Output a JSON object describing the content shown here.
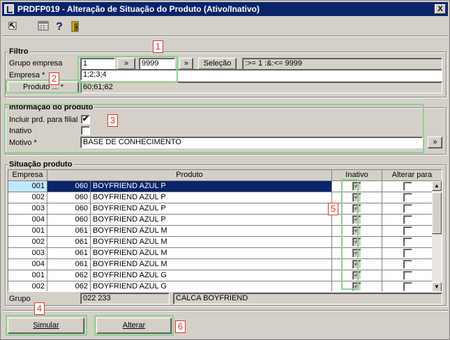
{
  "window": {
    "title": "PRDFP019 - Alteração de Situação do Produto (Ativo/Inativo)",
    "close_glyph": "X"
  },
  "toolbar": {
    "icons": [
      "cursor-icon",
      "calendar-icon",
      "help-icon",
      "exit-door-icon"
    ],
    "help_glyph": "?"
  },
  "filtro": {
    "legend": "Filtro",
    "grupo_label": "Grupo empresa",
    "grupo_from": "1",
    "grupo_to": "9999",
    "range_btn": "»",
    "range_btn2": "»",
    "selecao_btn": "Seleção",
    "selecao_text": ":>= 1 :&:<= 9999",
    "empresa_label": "Empresa *",
    "empresa_value": "1;2;3;4",
    "produto_btn": "Produto ... *",
    "produto_value": "60;61;62"
  },
  "info": {
    "legend": "Informação do produto",
    "incluir_label": "Incluir prd. para filial",
    "incluir_checked": "✔",
    "inativo_label": "Inativo",
    "motivo_label": "Motivo *",
    "motivo_value": "BASE DE CONHECIMENTO",
    "motivo_btn": "»"
  },
  "situacao": {
    "legend": "Situação produto",
    "columns": {
      "empresa": "Empresa",
      "produto": "Produto",
      "inativo": "Inativo",
      "alterar": "Alterar para"
    },
    "rows": [
      {
        "empresa": "001",
        "codigo": "060",
        "produto": "BOYFRIEND AZUL P"
      },
      {
        "empresa": "002",
        "codigo": "060",
        "produto": "BOYFRIEND AZUL P"
      },
      {
        "empresa": "003",
        "codigo": "060",
        "produto": "BOYFRIEND AZUL P"
      },
      {
        "empresa": "004",
        "codigo": "060",
        "produto": "BOYFRIEND AZUL P"
      },
      {
        "empresa": "001",
        "codigo": "061",
        "produto": "BOYFRIEND AZUL M"
      },
      {
        "empresa": "002",
        "codigo": "061",
        "produto": "BOYFRIEND AZUL M"
      },
      {
        "empresa": "003",
        "codigo": "061",
        "produto": "BOYFRIEND AZUL M"
      },
      {
        "empresa": "004",
        "codigo": "061",
        "produto": "BOYFRIEND AZUL M"
      },
      {
        "empresa": "001",
        "codigo": "062",
        "produto": "BOYFRIEND AZUL G"
      },
      {
        "empresa": "002",
        "codigo": "062",
        "produto": "BOYFRIEND AZUL G"
      }
    ],
    "inativo_glyph": "✔",
    "scroll_up": "▲",
    "scroll_down": "▼"
  },
  "grupo": {
    "label": "Grupo",
    "code": "022 233",
    "description": "CALCA BOYFRIEND"
  },
  "actions": {
    "simular": "Simular",
    "alterar": "Alterar"
  },
  "callouts": [
    "1",
    "2",
    "3",
    "4",
    "5",
    "6"
  ],
  "colors": {
    "title_bar": "#0a246a",
    "callout_box": "#8fd18f",
    "callout_number": "#dd3333"
  }
}
